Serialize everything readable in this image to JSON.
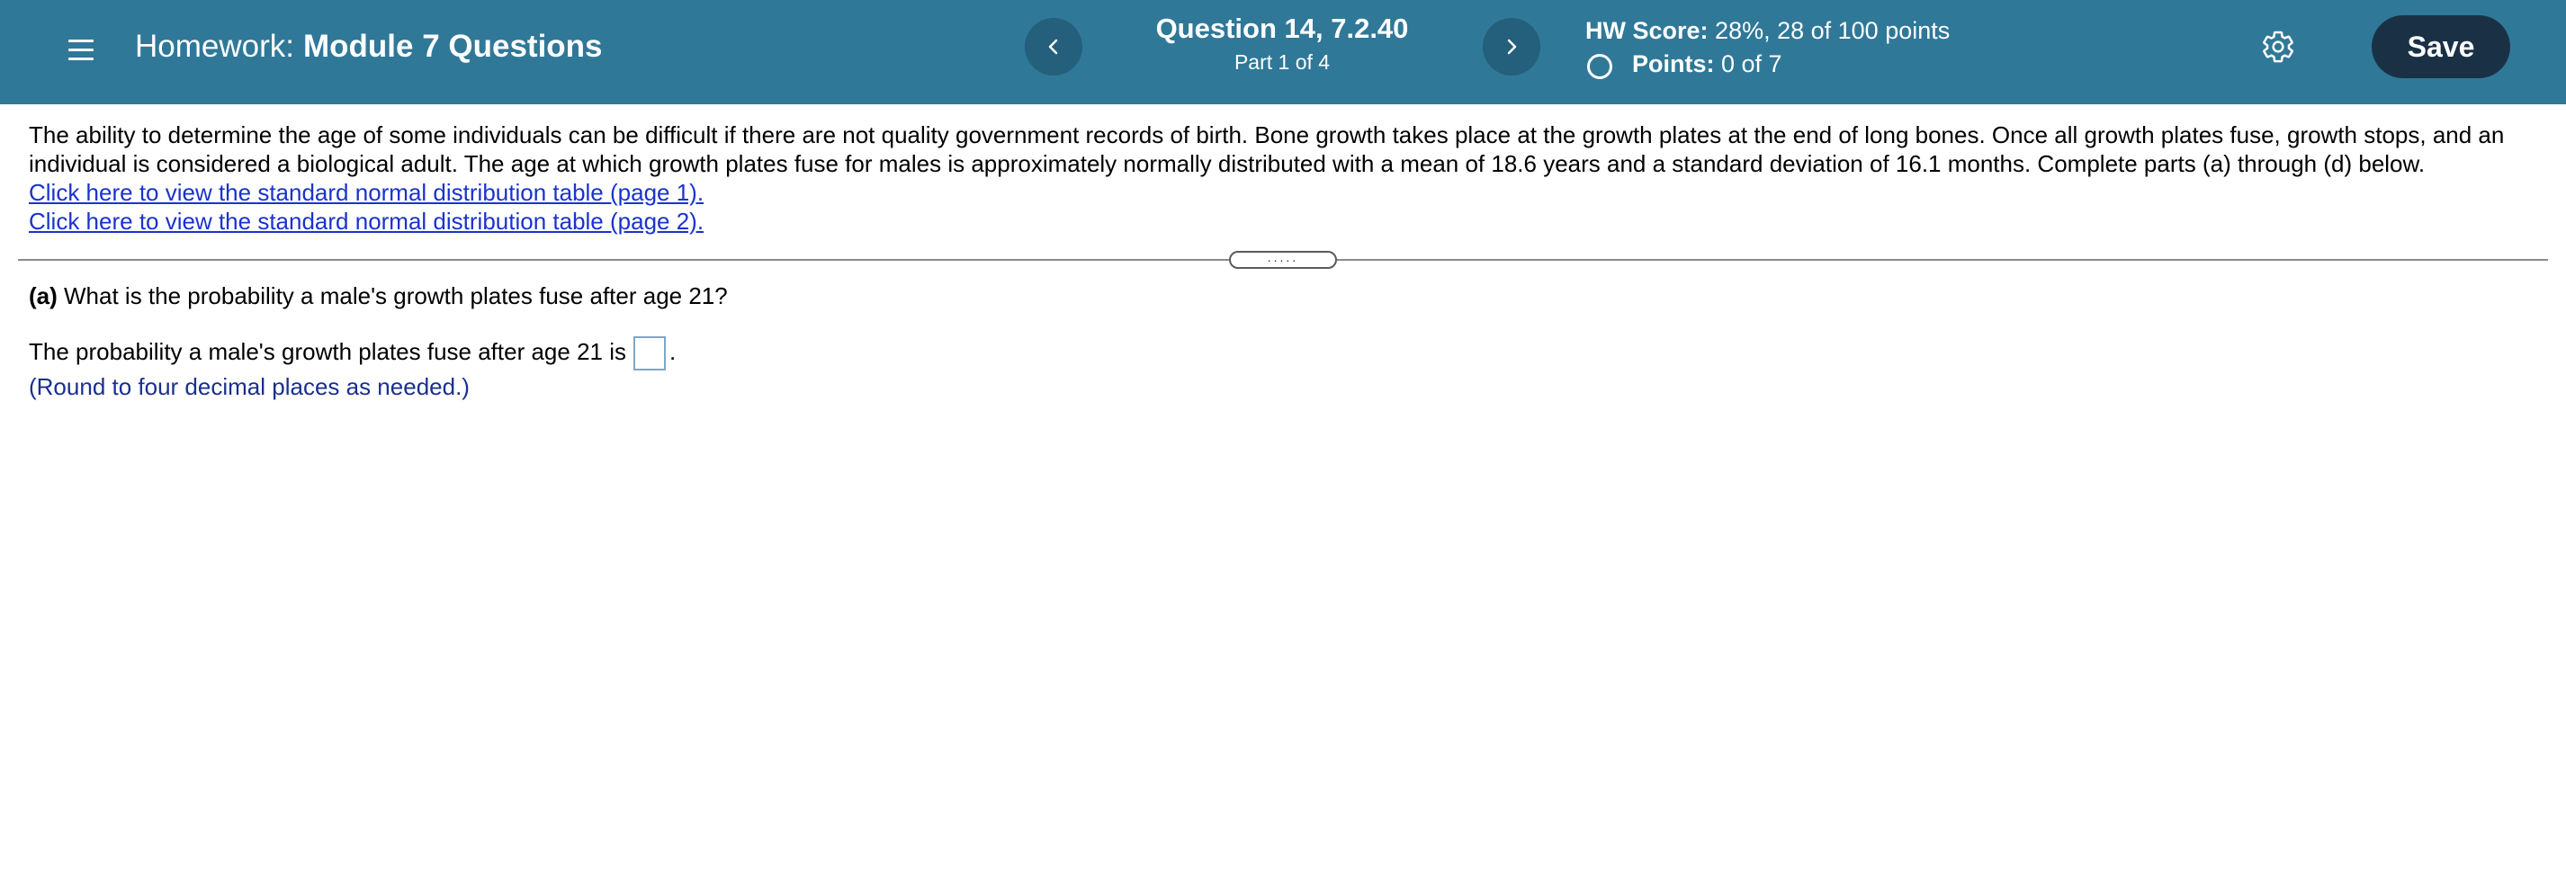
{
  "header": {
    "homework_prefix": "Homework:",
    "homework_name": "Module 7 Questions",
    "question_title": "Question 14, 7.2.40",
    "question_part": "Part 1 of 4",
    "hw_score_label": "HW Score:",
    "hw_score_value": "28%, 28 of 100 points",
    "points_label": "Points:",
    "points_value": "0 of 7",
    "save_label": "Save",
    "icons": {
      "menu": "hamburger-icon",
      "prev": "chevron-left-icon",
      "next": "chevron-right-icon",
      "points_status": "circle-outline-icon",
      "settings": "gear-icon"
    }
  },
  "content": {
    "intro": "The ability to determine the age of some individuals can be difficult if there are not quality government records of birth. Bone growth takes place at the growth plates at the end of long bones. Once all growth plates fuse, growth stops, and an individual is considered a biological adult. The age at which growth plates fuse for males is approximately normally distributed with a mean of 18.6 years and a standard deviation of 16.1 months. Complete parts (a) through (d) below.",
    "links": [
      "Click here to view the standard normal distribution table (page 1).",
      "Click here to view the standard normal distribution table (page 2)."
    ],
    "divider_handle": ".....",
    "part_label": "(a)",
    "part_question": "What is the probability a male's growth plates fuse after age 21?",
    "answer_prefix": "The probability a male's growth plates fuse after age 21 is",
    "answer_value": "",
    "answer_suffix": ".",
    "hint": "(Round to four decimal places as needed.)"
  },
  "colors": {
    "header_bg": "#2f7898",
    "nav_circle": "#245f7b",
    "save_bg": "#1a3145",
    "link": "#1a33cc",
    "hint": "#1a2f8f",
    "answer_box_border": "#7aa9c6"
  }
}
